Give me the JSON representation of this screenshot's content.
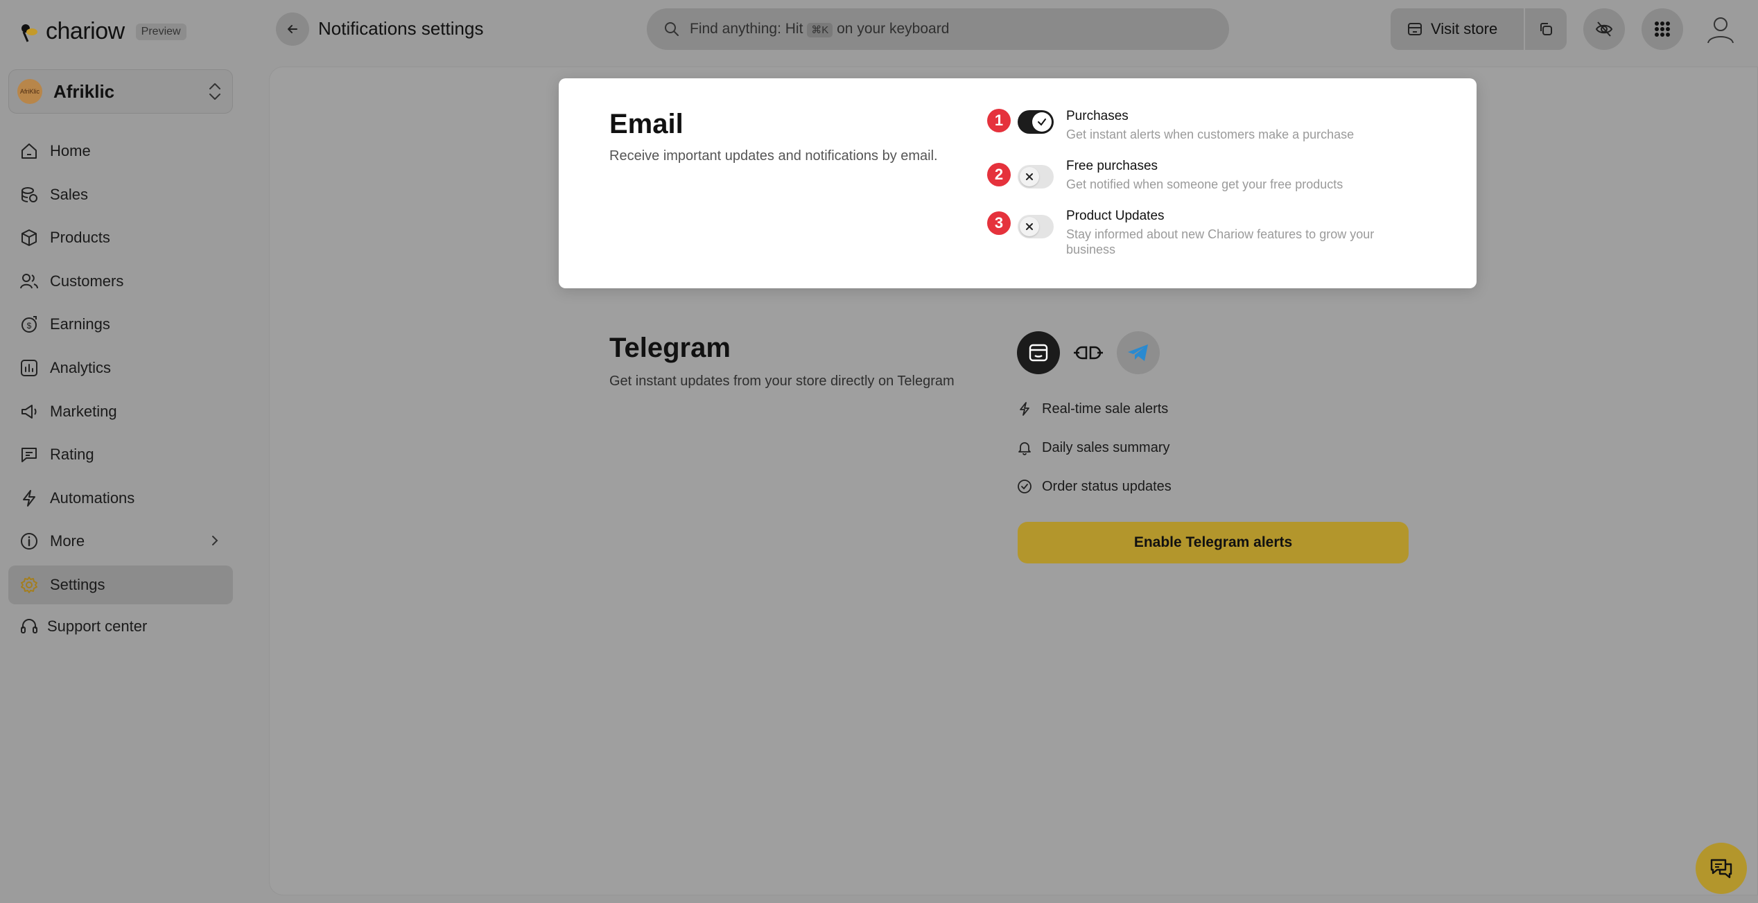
{
  "app": {
    "brand": "chariow",
    "preview_badge": "Preview"
  },
  "header": {
    "title": "Notifications settings",
    "search_text_before": "Find anything: Hit",
    "search_kbd": "⌘K",
    "search_text_after": "on your keyboard",
    "visit_store_label": "Visit store"
  },
  "workspace": {
    "name": "Afriklic",
    "avatar_text": "AfriKlic"
  },
  "sidebar": {
    "items": [
      {
        "label": "Home"
      },
      {
        "label": "Sales"
      },
      {
        "label": "Products"
      },
      {
        "label": "Customers"
      },
      {
        "label": "Earnings"
      },
      {
        "label": "Analytics"
      },
      {
        "label": "Marketing"
      },
      {
        "label": "Rating"
      },
      {
        "label": "Automations"
      },
      {
        "label": "More"
      },
      {
        "label": "Settings"
      }
    ],
    "support_label": "Support center"
  },
  "email": {
    "title": "Email",
    "description": "Receive important updates and notifications by email.",
    "preferences": [
      {
        "number": "1",
        "title": "Purchases",
        "description": "Get instant alerts when customers make a purchase",
        "enabled": true
      },
      {
        "number": "2",
        "title": "Free purchases",
        "description": "Get notified when someone get your free products",
        "enabled": false
      },
      {
        "number": "3",
        "title": "Product Updates",
        "description": "Stay informed about new Chariow features to grow your business",
        "enabled": false
      }
    ]
  },
  "telegram": {
    "title": "Telegram",
    "description": "Get instant updates from your store directly on Telegram",
    "features": [
      {
        "label": "Real-time sale alerts"
      },
      {
        "label": "Daily sales summary"
      },
      {
        "label": "Order status updates"
      }
    ],
    "button_label": "Enable Telegram alerts"
  },
  "colors": {
    "accent": "#b3962c",
    "badge_red": "#e5323c",
    "telegram_blue": "#2a8ad0"
  }
}
